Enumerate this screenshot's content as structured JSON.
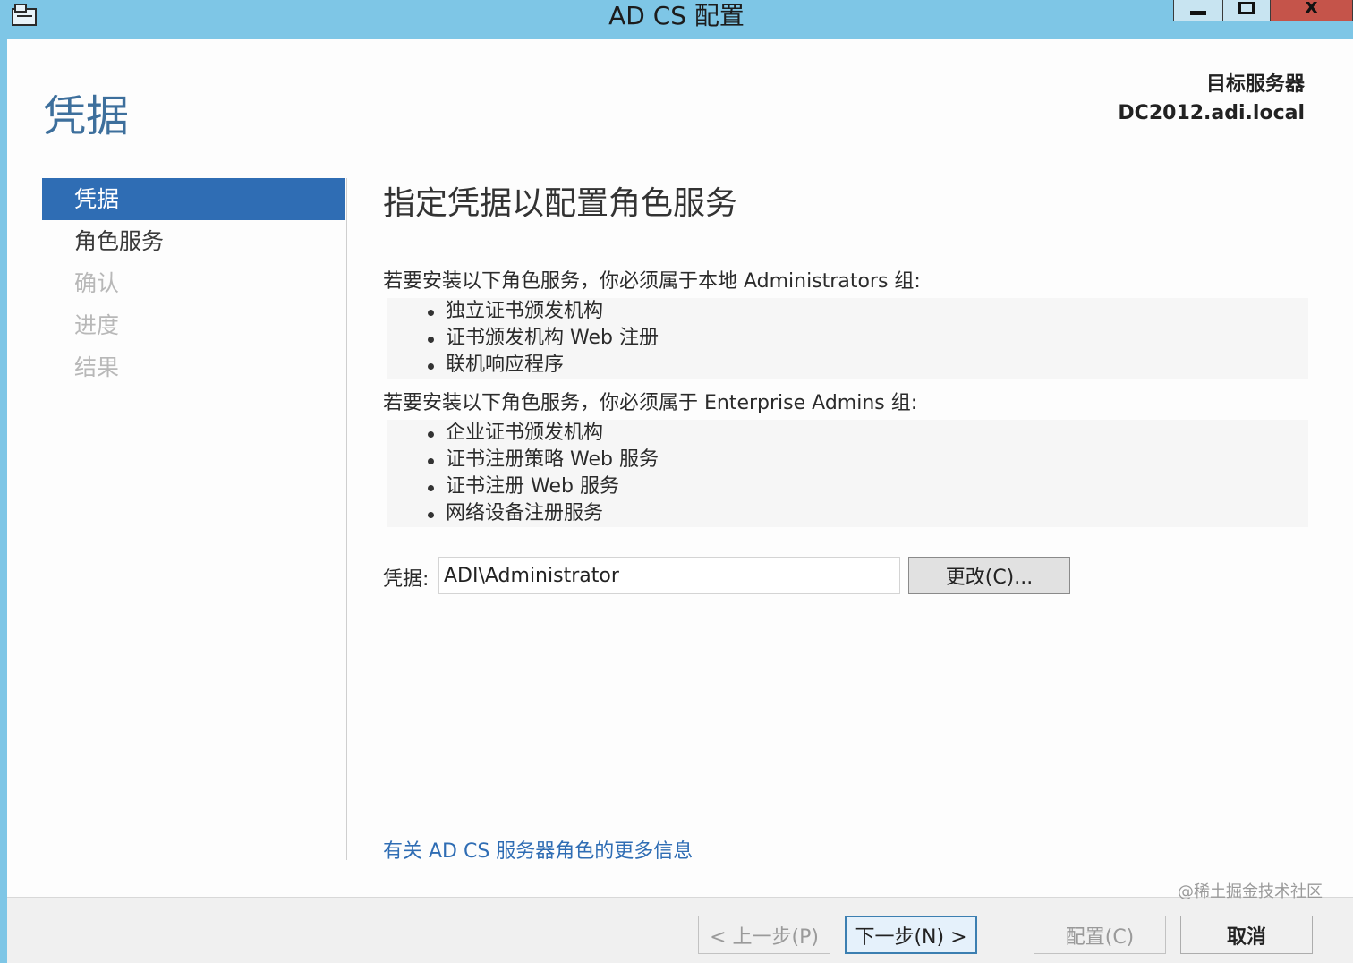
{
  "window": {
    "title": "AD CS 配置",
    "close_glyph": "x"
  },
  "header": {
    "page_title": "凭据",
    "target_server_label": "目标服务器",
    "target_server_value": "DC2012.adi.local"
  },
  "sidebar": {
    "items": [
      {
        "label": "凭据",
        "state": "active"
      },
      {
        "label": "角色服务",
        "state": "enabled"
      },
      {
        "label": "确认",
        "state": "disabled"
      },
      {
        "label": "进度",
        "state": "disabled"
      },
      {
        "label": "结果",
        "state": "disabled"
      }
    ]
  },
  "main": {
    "heading": "指定凭据以配置角色服务",
    "group1_intro": "若要安装以下角色服务，你必须属于本地 Administrators 组:",
    "group1_items": [
      "独立证书颁发机构",
      "证书颁发机构 Web 注册",
      "联机响应程序"
    ],
    "group2_intro": "若要安装以下角色服务，你必须属于 Enterprise Admins 组:",
    "group2_items": [
      "企业证书颁发机构",
      "证书注册策略 Web 服务",
      "证书注册 Web 服务",
      "网络设备注册服务"
    ],
    "credentials_label": "凭据:",
    "credentials_value": "ADI\\Administrator",
    "change_button": "更改(C)...",
    "more_info_link": "有关 AD CS 服务器角色的更多信息"
  },
  "footer": {
    "prev_button": "< 上一步(P)",
    "next_button": "下一步(N) >",
    "configure_button": "配置(C)",
    "cancel_button": "取消"
  },
  "watermark": "@稀土掘金技术社区",
  "colors": {
    "titlebar": "#7ec6e6",
    "accent": "#2f6db4",
    "close_button": "#c5544a"
  }
}
